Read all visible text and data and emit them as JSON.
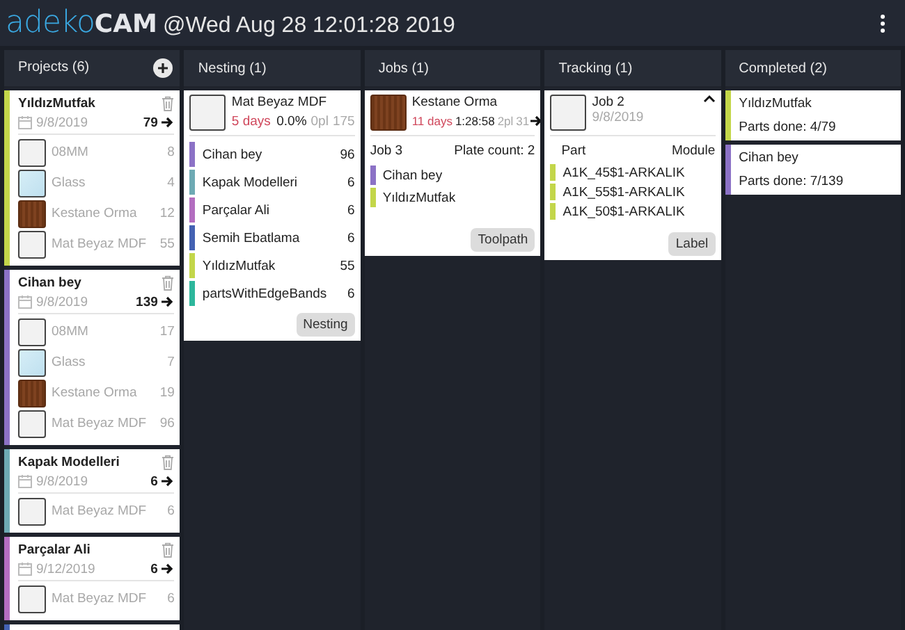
{
  "header": {
    "logo_light": "adeko",
    "logo_bold": "CAM",
    "timestamp": "@Wed Aug 28 12:01:28 2019"
  },
  "projects": {
    "title": "Projects (6)",
    "items": [
      {
        "name": "YıldızMutfak",
        "color": "#c3d64a",
        "date": "9/8/2019",
        "count": "79",
        "materials": [
          {
            "kind": "white",
            "name": "08MM",
            "count": "8"
          },
          {
            "kind": "glass",
            "name": "Glass",
            "count": "4"
          },
          {
            "kind": "wood",
            "name": "Kestane Orma",
            "count": "12"
          },
          {
            "kind": "white",
            "name": "Mat Beyaz MDF",
            "count": "55"
          }
        ]
      },
      {
        "name": "Cihan bey",
        "color": "#8c72c6",
        "date": "9/8/2019",
        "count": "139",
        "materials": [
          {
            "kind": "white",
            "name": "08MM",
            "count": "17"
          },
          {
            "kind": "glass",
            "name": "Glass",
            "count": "7"
          },
          {
            "kind": "wood",
            "name": "Kestane Orma",
            "count": "19"
          },
          {
            "kind": "white",
            "name": "Mat Beyaz MDF",
            "count": "96"
          }
        ]
      },
      {
        "name": "Kapak Modelleri",
        "color": "#6eaab4",
        "date": "9/8/2019",
        "count": "6",
        "materials": [
          {
            "kind": "white",
            "name": "Mat Beyaz MDF",
            "count": "6"
          }
        ]
      },
      {
        "name": "Parçalar Ali",
        "color": "#b36ec0",
        "date": "9/12/2019",
        "count": "6",
        "materials": [
          {
            "kind": "white",
            "name": "Mat Beyaz MDF",
            "count": "6"
          }
        ]
      },
      {
        "color": "#4462b3"
      }
    ]
  },
  "nesting": {
    "title": "Nesting (1)",
    "card": {
      "kind": "white",
      "material": "Mat Beyaz MDF",
      "age": "5 days",
      "percent": "0.0%",
      "plates": "0pl",
      "parts": "175",
      "rows": [
        {
          "name": "Cihan bey",
          "color": "#8c72c6",
          "count": "96"
        },
        {
          "name": "Kapak Modelleri",
          "color": "#6eaab4",
          "count": "6"
        },
        {
          "name": "Parçalar Ali",
          "color": "#b36ec0",
          "count": "6"
        },
        {
          "name": "Semih Ebatlama",
          "color": "#4462b3",
          "count": "6"
        },
        {
          "name": "YıldızMutfak",
          "color": "#c3d64a",
          "count": "55"
        },
        {
          "name": "partsWithEdgeBands",
          "color": "#2db79c",
          "count": "6"
        }
      ],
      "button": "Nesting"
    }
  },
  "jobs": {
    "title": "Jobs (1)",
    "card": {
      "kind": "wood",
      "material": "Kestane Orma",
      "age": "11 days",
      "time": "1:28:58",
      "plates": "2pl",
      "parts": "31",
      "job": "Job 3",
      "plate_count": "Plate count: 2",
      "rows": [
        {
          "name": "Cihan bey",
          "color": "#8c72c6"
        },
        {
          "name": "YıldızMutfak",
          "color": "#c3d64a"
        }
      ],
      "button": "Toolpath"
    }
  },
  "tracking": {
    "title": "Tracking (1)",
    "card": {
      "kind": "white",
      "job": "Job 2",
      "date": "9/8/2019",
      "expanded": true,
      "col_part": "Part",
      "col_module": "Module",
      "parts": [
        {
          "name": "A1K_45$1-ARKALIK",
          "color": "#c3d64a"
        },
        {
          "name": "A1K_55$1-ARKALIK",
          "color": "#c3d64a"
        },
        {
          "name": "A1K_50$1-ARKALIK",
          "color": "#c3d64a"
        }
      ],
      "button": "Label"
    }
  },
  "completed": {
    "title": "Completed (2)",
    "items": [
      {
        "name": "YıldızMutfak",
        "color": "#c3d64a",
        "progress": "Parts done: 4/79"
      },
      {
        "name": "Cihan bey",
        "color": "#8c72c6",
        "progress": "Parts done: 7/139"
      }
    ]
  }
}
